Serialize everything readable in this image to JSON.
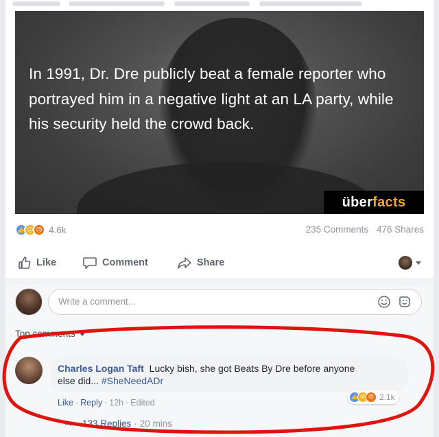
{
  "post": {
    "fact_text": "In 1991, Dr. Dre publicly beat a female reporter who portrayed him in a negative light at an LA party, while his security held the crowd back.",
    "brand": {
      "part1": "über",
      "part2": "facts",
      "accent_color": "#f5a623"
    }
  },
  "stats": {
    "reaction_count": "4.6k",
    "comments": "235 Comments",
    "shares": "476 Shares"
  },
  "actions": {
    "like": "Like",
    "comment": "Comment",
    "share": "Share"
  },
  "composer": {
    "placeholder": "Write a comment..."
  },
  "top_comments_label": "Top comments",
  "comment": {
    "author": "Charles Logan Taft",
    "body": "Lucky bish, she got Beats By Dre before anyone else did...",
    "hashtag": "#SheNeedADr",
    "like": "Like",
    "reply": "Reply",
    "time": "12h",
    "edited": "Edited",
    "reaction_count": "2.1k"
  },
  "replies": {
    "label": "133 Replies",
    "time": "20 mins"
  },
  "colors": {
    "link_blue": "#385898",
    "like_blue": "#5890ff",
    "wow_yellow": "#f7b125",
    "angry_orange": "#e9710f",
    "annotation_red": "#e0140f"
  }
}
